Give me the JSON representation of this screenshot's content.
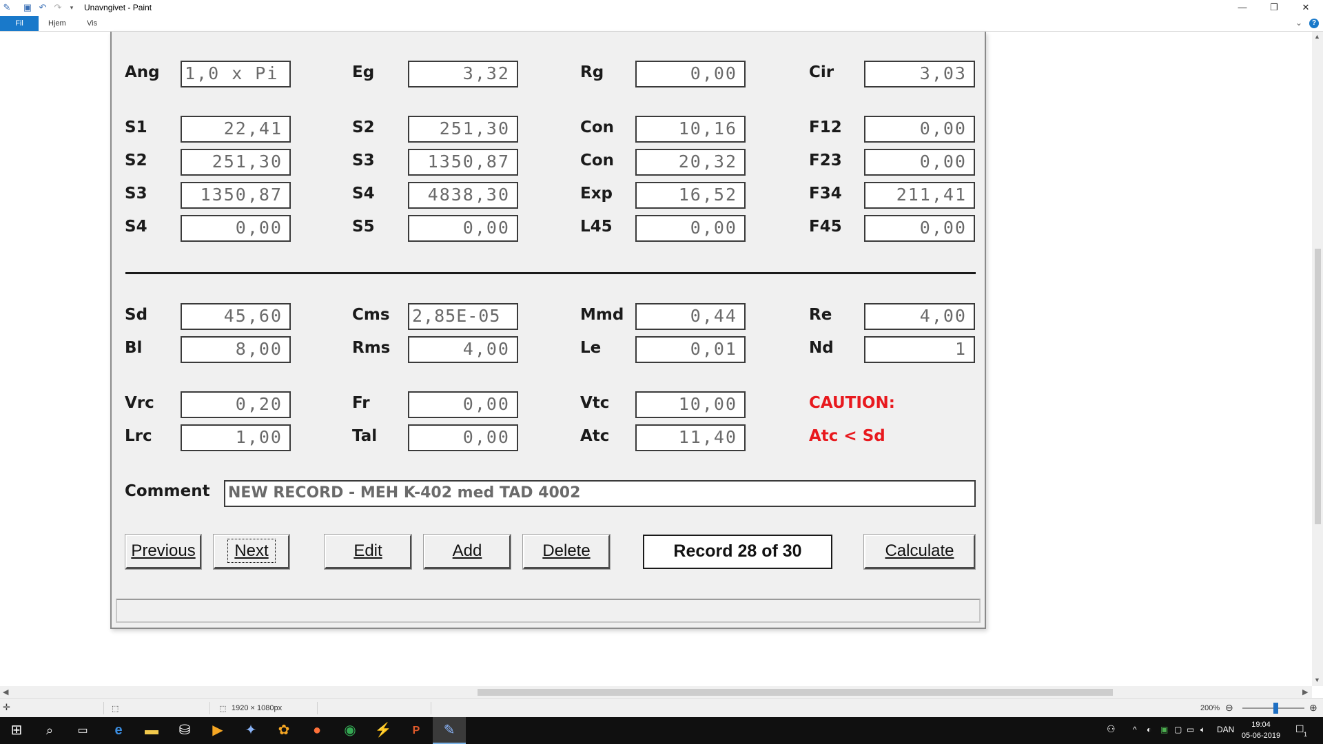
{
  "window": {
    "title": "Unavngivet - Paint",
    "minimize_glyph": "—",
    "restore_glyph": "❐",
    "close_glyph": "✕"
  },
  "ribbon": {
    "tabs": [
      "Fil",
      "Hjem",
      "Vis"
    ],
    "help_glyph": "?"
  },
  "app": {
    "rows": [
      [
        {
          "label": "Ang",
          "value": "1,0 x Pi"
        },
        {
          "label": "Eg",
          "value": "3,32"
        },
        {
          "label": "Rg",
          "value": "0,00"
        },
        {
          "label": "Cir",
          "value": "3,03"
        }
      ],
      [
        {
          "label": "S1",
          "value": "22,41"
        },
        {
          "label": "S2",
          "value": "251,30"
        },
        {
          "label": "Con",
          "value": "10,16"
        },
        {
          "label": "F12",
          "value": "0,00"
        }
      ],
      [
        {
          "label": "S2",
          "value": "251,30"
        },
        {
          "label": "S3",
          "value": "1350,87"
        },
        {
          "label": "Con",
          "value": "20,32"
        },
        {
          "label": "F23",
          "value": "0,00"
        }
      ],
      [
        {
          "label": "S3",
          "value": "1350,87"
        },
        {
          "label": "S4",
          "value": "4838,30"
        },
        {
          "label": "Exp",
          "value": "16,52"
        },
        {
          "label": "F34",
          "value": "211,41"
        }
      ],
      [
        {
          "label": "S4",
          "value": "0,00"
        },
        {
          "label": "S5",
          "value": "0,00"
        },
        {
          "label": "L45",
          "value": "0,00"
        },
        {
          "label": "F45",
          "value": "0,00"
        }
      ],
      [
        {
          "label": "Sd",
          "value": "45,60"
        },
        {
          "label": "Cms",
          "value": "2,85E-05"
        },
        {
          "label": "Mmd",
          "value": "0,44"
        },
        {
          "label": "Re",
          "value": "4,00"
        }
      ],
      [
        {
          "label": "Bl",
          "value": "8,00"
        },
        {
          "label": "Rms",
          "value": "4,00"
        },
        {
          "label": "Le",
          "value": "0,01"
        },
        {
          "label": "Nd",
          "value": "1"
        }
      ],
      [
        {
          "label": "Vrc",
          "value": "0,20"
        },
        {
          "label": "Fr",
          "value": "0,00"
        },
        {
          "label": "Vtc",
          "value": "10,00"
        }
      ],
      [
        {
          "label": "Lrc",
          "value": "1,00"
        },
        {
          "label": "Tal",
          "value": "0,00"
        },
        {
          "label": "Atc",
          "value": "11,40"
        }
      ]
    ],
    "caution_title": "CAUTION:",
    "caution_text": "Atc < Sd",
    "caution_color": "#e8191e",
    "comment_label": "Comment",
    "comment_value": "NEW RECORD - MEH K-402 med TAD 4002",
    "buttons": {
      "previous": "Previous",
      "next": "Next",
      "edit": "Edit",
      "add": "Add",
      "delete": "Delete",
      "calculate": "Calculate"
    },
    "record_status": "Record 28 of 30"
  },
  "paint_status": {
    "dimensions": "1920 × 1080px",
    "zoom": "200%"
  },
  "taskbar": {
    "language": "DAN",
    "time": "19:04",
    "date": "05-06-2019",
    "notification_count": "1"
  }
}
